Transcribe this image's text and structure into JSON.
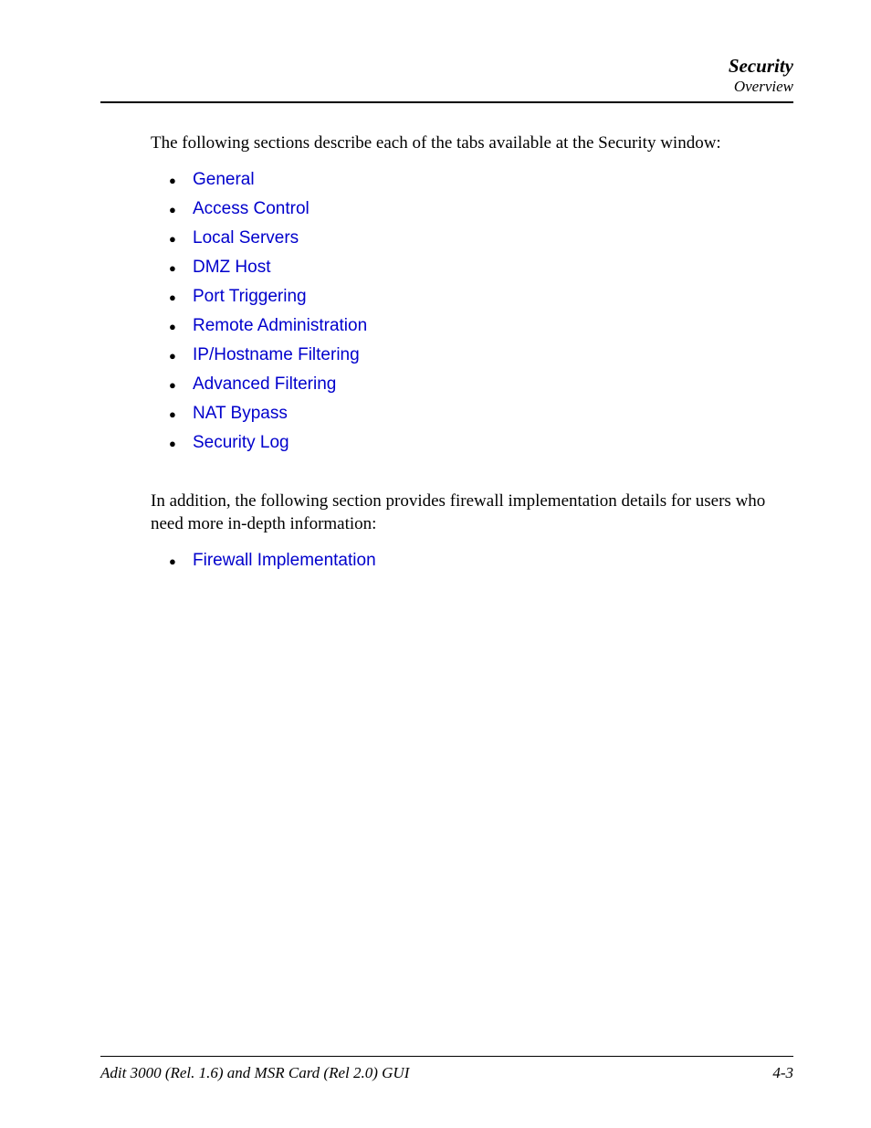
{
  "header": {
    "title": "Security",
    "subtitle": "Overview"
  },
  "content": {
    "intro1": "The following sections describe each of the tabs available at the Security window:",
    "list1": [
      "General",
      "Access Control",
      "Local Servers",
      "DMZ Host",
      "Port Triggering",
      "Remote Administration",
      "IP/Hostname Filtering",
      "Advanced Filtering",
      "NAT Bypass",
      "Security Log"
    ],
    "intro2": "In addition, the following section provides firewall implementation details for users who need more in-depth information:",
    "list2": [
      "Firewall Implementation"
    ]
  },
  "footer": {
    "left": "Adit 3000 (Rel. 1.6) and MSR Card (Rel 2.0) GUI",
    "right": "4-3"
  }
}
